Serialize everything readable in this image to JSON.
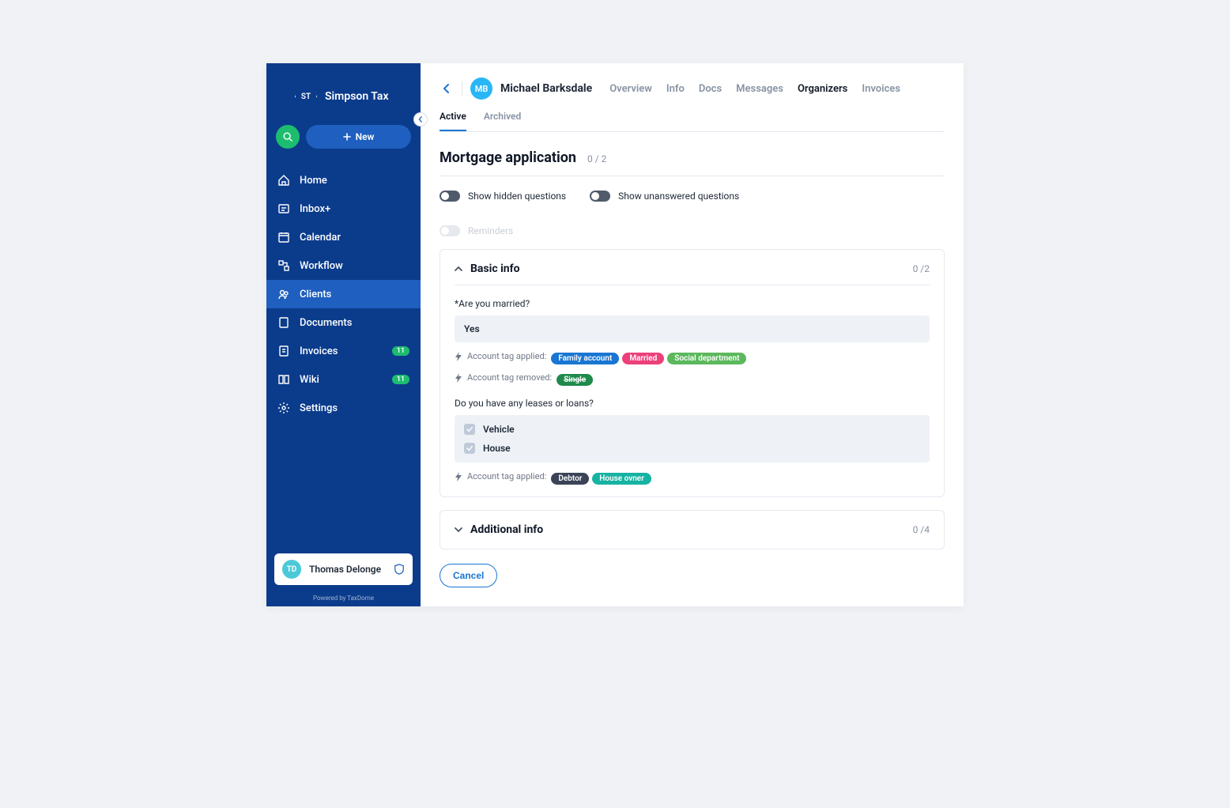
{
  "brand": {
    "initials": "ST",
    "name": "Simpson Tax",
    "powered": "Powered by TaxDome"
  },
  "actions": {
    "new_label": "New"
  },
  "nav": {
    "items": [
      {
        "label": "Home",
        "icon": "home"
      },
      {
        "label": "Inbox+",
        "icon": "inbox"
      },
      {
        "label": "Calendar",
        "icon": "calendar"
      },
      {
        "label": "Workflow",
        "icon": "workflow"
      },
      {
        "label": "Clients",
        "icon": "clients",
        "active": true
      },
      {
        "label": "Documents",
        "icon": "documents"
      },
      {
        "label": "Invoices",
        "icon": "invoices",
        "badge": "11"
      },
      {
        "label": "Wiki",
        "icon": "wiki",
        "badge": "11"
      },
      {
        "label": "Settings",
        "icon": "settings"
      }
    ]
  },
  "user": {
    "initials": "TD",
    "name": "Thomas Delonge"
  },
  "client": {
    "initials": "MB",
    "name": "Michael Barksdale"
  },
  "detail_tabs": [
    "Overview",
    "Info",
    "Docs",
    "Messages",
    "Organizers",
    "Invoices"
  ],
  "detail_tab_active": "Organizers",
  "sub_tabs": [
    "Active",
    "Archived"
  ],
  "sub_tab_active": "Active",
  "page": {
    "title": "Mortgage application",
    "count": "0 / 2"
  },
  "toggles": {
    "hidden": "Show hidden questions",
    "unanswered": "Show unanswered questions",
    "reminders": "Reminders"
  },
  "basic": {
    "title": "Basic info",
    "count": "0 /2",
    "q1": {
      "label": "*Are you married?",
      "answer": "Yes"
    },
    "applied_label": "Account tag applied:",
    "removed_label": "Account tag removed:",
    "tags_applied_1": [
      {
        "text": "Family account",
        "color": "#1976d2"
      },
      {
        "text": "Married",
        "color": "#ec407a"
      },
      {
        "text": "Social department",
        "color": "#5cb85c"
      }
    ],
    "tags_removed_1": [
      {
        "text": "Single",
        "color": "#1f8a4c",
        "strike": true
      }
    ],
    "q2": {
      "label": "Do you have any leases or loans?",
      "options": [
        "Vehicle",
        "House"
      ]
    },
    "tags_applied_2": [
      {
        "text": "Debtor",
        "color": "#3b4457"
      },
      {
        "text": "House ovner",
        "color": "#16b3a3"
      }
    ]
  },
  "additional": {
    "title": "Additional info",
    "count": "0 /4"
  },
  "cancel": "Cancel"
}
